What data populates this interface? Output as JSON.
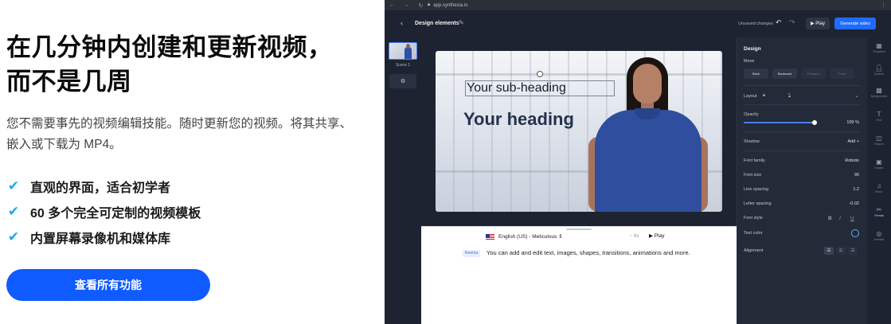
{
  "hero": {
    "title_line1": "在几分钟内创建和更新视频，",
    "title_line2": "而不是几周",
    "description": "您不需要事先的视频编辑技能。随时更新您的视频。将其共享、嵌入或下载为 MP4。",
    "features": [
      "直观的界面，适合初学者",
      "60 多个完全可定制的视频模板",
      "内置屏幕录像机和媒体库"
    ],
    "cta_label": "查看所有功能",
    "accent_color": "#0f5bff",
    "check_color": "#1ea8ea"
  },
  "browser": {
    "url": "app.synthesia.io",
    "nav_icons": [
      "arrow-left-icon",
      "arrow-right-icon",
      "reload-icon"
    ]
  },
  "topbar": {
    "title": "Design elements",
    "unsaved": "Unsaved changes",
    "play_label": "▶ Play",
    "generate_label": "Generate video"
  },
  "scenes": {
    "items": [
      {
        "label": "Scene 1"
      }
    ],
    "add_icon": "gear-icon"
  },
  "canvas": {
    "sub_heading": "Your sub-heading",
    "heading": "Your heading"
  },
  "script": {
    "voice": "English (US) - Meticulous ⇕",
    "duration": "~ 6s",
    "play_label": "▶ Play",
    "speaker": "Reema",
    "text": "You can add and edit text, images, shapes, transitions, animations and more."
  },
  "props": {
    "title": "Design",
    "move_label": "Move",
    "move_buttons": [
      "Back",
      "Backward",
      "Forward",
      "Front"
    ],
    "layout_label": "Layout",
    "opacity_label": "Opacity",
    "opacity_value": "100 %",
    "opacity_fraction": 1.0,
    "shadow_label": "Shadow",
    "shadow_action": "Add +",
    "font_family_label": "Font family",
    "font_family_value": "Roboto",
    "font_size_label": "Font size",
    "font_size_value": "90",
    "line_spacing_label": "Line spacing",
    "line_spacing_value": "1.2",
    "letter_spacing_label": "Letter spacing",
    "letter_spacing_value": "-0.02",
    "font_style_label": "Font style",
    "text_color_label": "Text color",
    "alignment_label": "Alignment"
  },
  "tools": [
    {
      "label": "Templates"
    },
    {
      "label": "Avatars"
    },
    {
      "label": "Backgrounds"
    },
    {
      "label": "Text"
    },
    {
      "label": "Shapes"
    },
    {
      "label": "Images"
    },
    {
      "label": "Music"
    },
    {
      "label": "Format"
    },
    {
      "label": "Animate"
    }
  ]
}
